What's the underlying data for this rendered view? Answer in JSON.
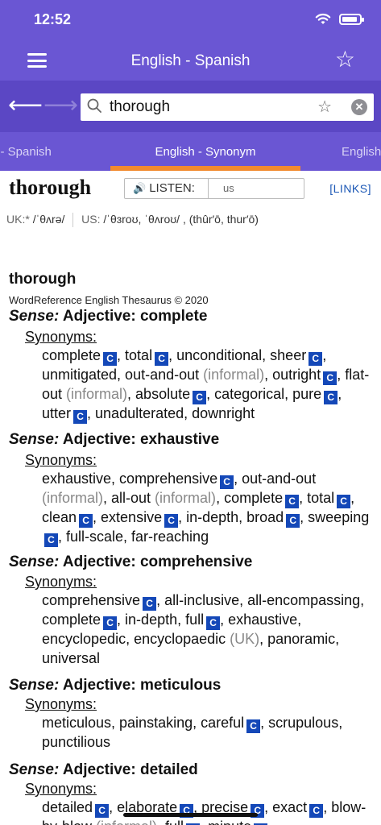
{
  "status": {
    "time": "12:52"
  },
  "nav": {
    "title": "English - Spanish"
  },
  "search": {
    "value": "thorough"
  },
  "tabs": {
    "left": "h - Spanish",
    "center": "English - Synonym",
    "right": "English"
  },
  "entry": {
    "headword": "thorough",
    "listen_label": "LISTEN:",
    "accent_option": "us",
    "links_label": "[LINKS]",
    "uk_label": "UK:*",
    "uk_ipa": "/ˈθʌrə/",
    "us_label": "US:",
    "us_ipa": "/ˈθɜroʊ, ˈθʌroʊ/ , (thûr′ō, thur′ō)"
  },
  "thesaurus": {
    "word": "thorough",
    "copyright": "WordReference English Thesaurus © 2020",
    "synonyms_label": "Synonyms:",
    "sense_prefix": "Sense:",
    "senses": [
      {
        "title": "Adjective: complete"
      },
      {
        "title": "Adjective: exhaustive"
      },
      {
        "title": "Adjective: comprehensive"
      },
      {
        "title": "Adjective: meticulous"
      },
      {
        "title": "Adjective: detailed"
      }
    ]
  },
  "colors": {
    "accent": "#6a56d3",
    "search_row": "#5b47c4",
    "tab_underline": "#f28a2e",
    "badge": "#1448b8",
    "links": "#1b57b5"
  },
  "icons": [
    "menu-icon",
    "star-icon",
    "back-arrow-icon",
    "forward-arrow-icon",
    "search-icon",
    "clear-icon",
    "speaker-icon",
    "wifi-icon",
    "battery-icon"
  ]
}
